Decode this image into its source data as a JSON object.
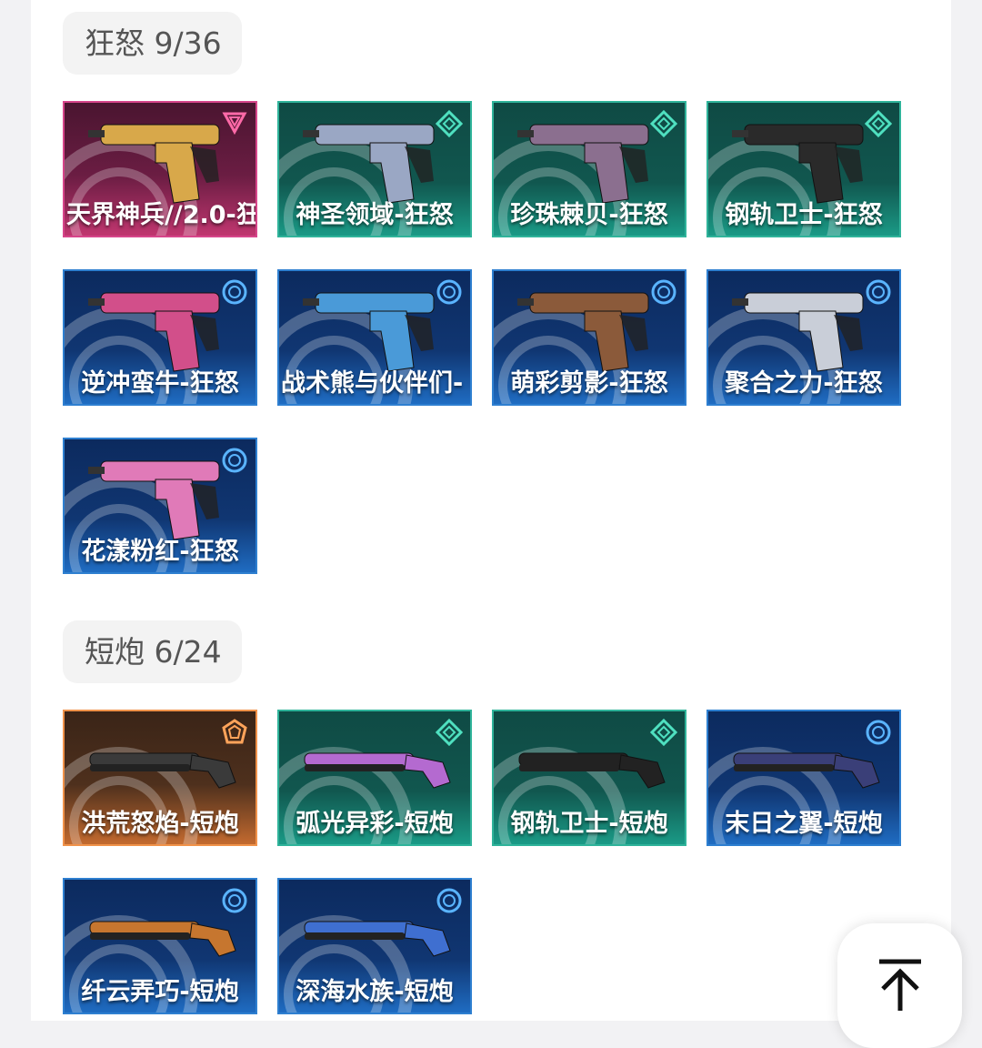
{
  "sections": [
    {
      "title": "狂怒",
      "count": "9/36",
      "items": [
        {
          "name": "天界神兵//2.0-狂",
          "tier": "exclusive",
          "color": "#d8a84a"
        },
        {
          "name": "神圣领域-狂怒",
          "tier": "premium",
          "color": "#9aa7c4"
        },
        {
          "name": "珍珠棘贝-狂怒",
          "tier": "premium",
          "color": "#8b6f8f"
        },
        {
          "name": "钢轨卫士-狂怒",
          "tier": "premium",
          "color": "#2a2a2a"
        },
        {
          "name": "逆冲蛮牛-狂怒",
          "tier": "deluxe",
          "color": "#d24f8a"
        },
        {
          "name": "战术熊与伙伴们-",
          "tier": "deluxe",
          "color": "#4a9ad8"
        },
        {
          "name": "萌彩剪影-狂怒",
          "tier": "deluxe",
          "color": "#8b5a3a"
        },
        {
          "name": "聚合之力-狂怒",
          "tier": "deluxe",
          "color": "#c9ced8"
        },
        {
          "name": "花漾粉红-狂怒",
          "tier": "deluxe",
          "color": "#e07ab8"
        }
      ]
    },
    {
      "title": "短炮",
      "count": "6/24",
      "items": [
        {
          "name": "洪荒怒焰-短炮",
          "tier": "ultra",
          "color": "#3a3a3a"
        },
        {
          "name": "弧光异彩-短炮",
          "tier": "premium",
          "color": "#b46ad0"
        },
        {
          "name": "钢轨卫士-短炮",
          "tier": "premium",
          "color": "#222222"
        },
        {
          "name": "末日之翼-短炮",
          "tier": "deluxe",
          "color": "#3a3f78"
        },
        {
          "name": "纤云弄巧-短炮",
          "tier": "deluxe",
          "color": "#c6762f"
        },
        {
          "name": "深海水族-短炮",
          "tier": "deluxe",
          "color": "#3f6fd0"
        }
      ]
    }
  ],
  "back_to_top": {
    "icon": "arrow-up-to-top-icon"
  }
}
